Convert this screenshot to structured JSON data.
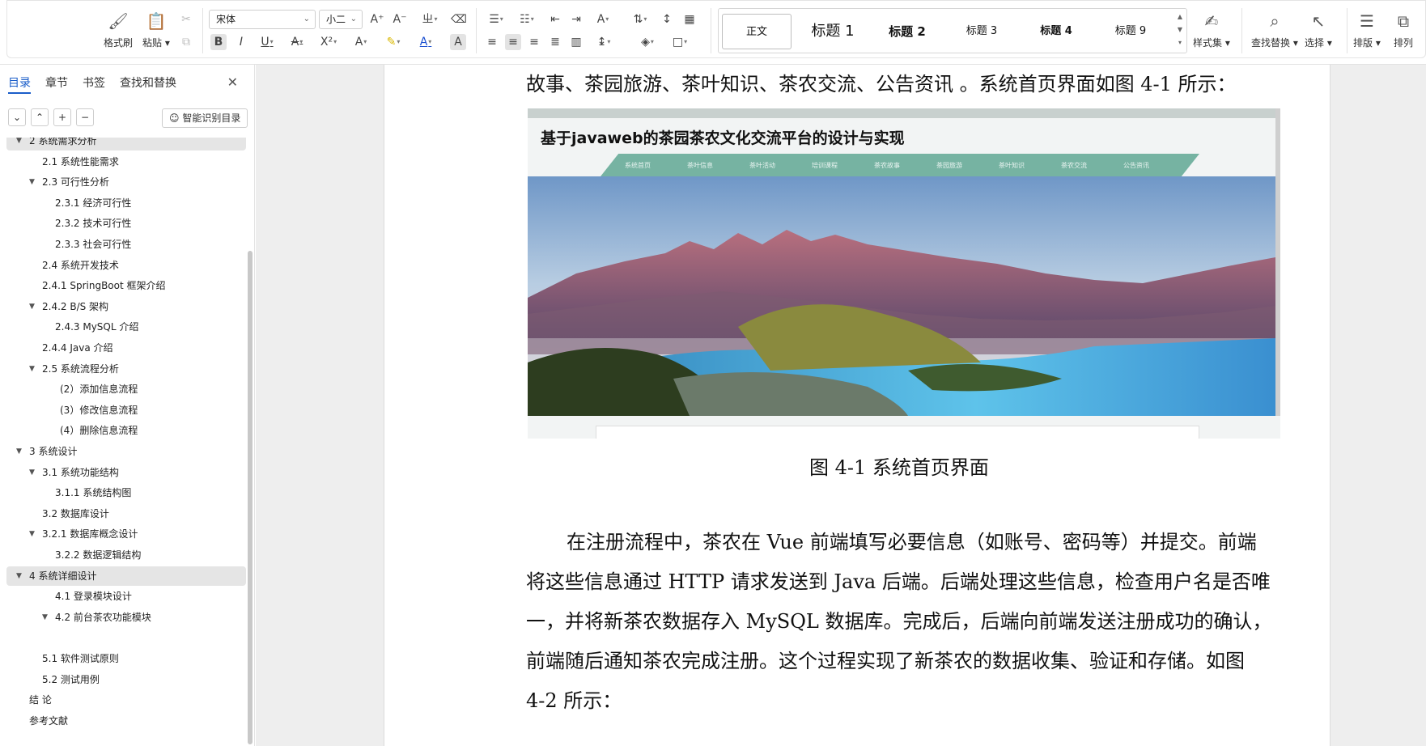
{
  "ribbon": {
    "format_painter": "格式刷",
    "paste": "粘贴",
    "font_name": "宋体",
    "font_size": "小二",
    "styles": [
      "正文",
      "标题 1",
      "标题 2",
      "标题 3",
      "标题 4",
      "标题 9"
    ],
    "style_set": "样式集",
    "find_replace": "查找替换",
    "select": "选择",
    "layout": "排版",
    "arrange": "排列"
  },
  "nav": {
    "tabs": [
      "目录",
      "章节",
      "书签",
      "查找和替换"
    ],
    "active_tab": "目录",
    "smart_toc": "智能识别目录",
    "items": [
      {
        "text": "2 系统需求分析",
        "indent": 1,
        "twisty": "▼",
        "selected": true
      },
      {
        "text": "2.1 系统性能需求",
        "indent": 2,
        "twisty": ""
      },
      {
        "text": "2.3 可行性分析",
        "indent": 2,
        "twisty": "▼"
      },
      {
        "text": "2.3.1 经济可行性",
        "indent": 3,
        "twisty": ""
      },
      {
        "text": "2.3.2 技术可行性",
        "indent": 3,
        "twisty": ""
      },
      {
        "text": "2.3.3 社会可行性",
        "indent": 3,
        "twisty": ""
      },
      {
        "text": "2.4 系统开发技术",
        "indent": 2,
        "twisty": ""
      },
      {
        "text": "2.4.1    SpringBoot 框架介绍",
        "indent": 2,
        "twisty": ""
      },
      {
        "text": "2.4.2    B/S 架构",
        "indent": 2,
        "twisty": "▼"
      },
      {
        "text": "2.4.3 MySQL 介绍",
        "indent": 3,
        "twisty": ""
      },
      {
        "text": "2.4.4 Java 介绍",
        "indent": 2,
        "twisty": ""
      },
      {
        "text": "2.5 系统流程分析",
        "indent": 2,
        "twisty": "▼"
      },
      {
        "text": "(2）添加信息流程",
        "indent": 4,
        "twisty": ""
      },
      {
        "text": "(3）修改信息流程",
        "indent": 4,
        "twisty": ""
      },
      {
        "text": "(4）删除信息流程",
        "indent": 4,
        "twisty": ""
      },
      {
        "text": "3 系统设计",
        "indent": 1,
        "twisty": "▼"
      },
      {
        "text": "3.1 系统功能结构",
        "indent": 2,
        "twisty": "▼"
      },
      {
        "text": "3.1.1 系统结构图",
        "indent": 3,
        "twisty": ""
      },
      {
        "text": "3.2 数据库设计",
        "indent": 2,
        "twisty": ""
      },
      {
        "text": "3.2.1  数据库概念设计",
        "indent": 2,
        "twisty": "▼"
      },
      {
        "text": "3.2.2 数据逻辑结构",
        "indent": 3,
        "twisty": ""
      },
      {
        "text": "4 系统详细设计",
        "indent": 1,
        "twisty": "▼",
        "selected": true
      },
      {
        "text": "4.1 登录模块设计",
        "indent": 3,
        "twisty": ""
      },
      {
        "text": "4.2  前台茶农功能模块",
        "indent": 3,
        "twisty": "▼"
      },
      {
        "text": "",
        "indent": 3,
        "twisty": ""
      },
      {
        "text": "5.1 软件测试原则",
        "indent": 2,
        "twisty": ""
      },
      {
        "text": "5.2 测试用例",
        "indent": 2,
        "twisty": ""
      },
      {
        "text": "结    论",
        "indent": 0,
        "twisty": ""
      },
      {
        "text": "参考文献",
        "indent": 0,
        "twisty": ""
      }
    ]
  },
  "document": {
    "line_top": "故事、茶园旅游、茶叶知识、茶农交流、公告资讯  。系统首页界面如图 4-1 所示：",
    "figure_caption": "图 4-1 系统首页界面",
    "para_lines": [
      "在注册流程中，茶农在 Vue 前端填写必要信息（如账号、密码等）并提交。前端",
      "将这些信息通过 HTTP 请求发送到 Java 后端。后端处理这些信息，检查用户名是否唯",
      "一，并将新茶农数据存入 MySQL 数据库。完成后，后端向前端发送注册成功的确认，",
      "前端随后通知茶农完成注册。这个过程实现了新茶农的数据收集、验证和存储。如图",
      "4-2 所示："
    ]
  },
  "figure": {
    "site_title": "基于javaweb的茶园茶农文化交流平台的设计与实现",
    "nav_items": [
      "系统首页",
      "茶叶信息",
      "茶叶活动",
      "培训课程",
      "茶农故事",
      "茶园旅游",
      "茶叶知识",
      "茶农交流",
      "公告资讯"
    ]
  }
}
